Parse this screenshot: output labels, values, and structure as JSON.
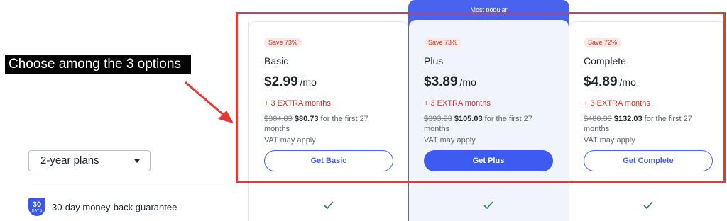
{
  "annotation": {
    "text": "Choose among the 3 options",
    "color": "#e53935"
  },
  "plan_selector": {
    "value": "2-year plans"
  },
  "guarantee": {
    "badge_number": "30",
    "badge_unit": "DAYS",
    "text": "30-day money-back guarantee"
  },
  "popular_label": "Most popular",
  "plans": [
    {
      "badge": "Save 73%",
      "name": "Basic",
      "price": "$2.99",
      "period": "/mo",
      "extra": "+ 3 EXTRA months",
      "old_price": "$304.83",
      "new_price": "$80.73",
      "term": "for the first 27 months",
      "vat": "VAT may apply",
      "button": "Get Basic"
    },
    {
      "badge": "Save 73%",
      "name": "Plus",
      "price": "$3.89",
      "period": "/mo",
      "extra": "+ 3 EXTRA months",
      "old_price": "$393.93",
      "new_price": "$105.03",
      "term": "for the first 27 months",
      "vat": "VAT may apply",
      "button": "Get Plus"
    },
    {
      "badge": "Save 72%",
      "name": "Complete",
      "price": "$4.89",
      "period": "/mo",
      "extra": "+ 3 EXTRA months",
      "old_price": "$480.33",
      "new_price": "$132.03",
      "term": "for the first 27 months",
      "vat": "VAT may apply",
      "button": "Get Complete"
    }
  ],
  "colors": {
    "accent": "#3d5af1",
    "check": "#2e7d4f",
    "discount": "#d93025"
  }
}
